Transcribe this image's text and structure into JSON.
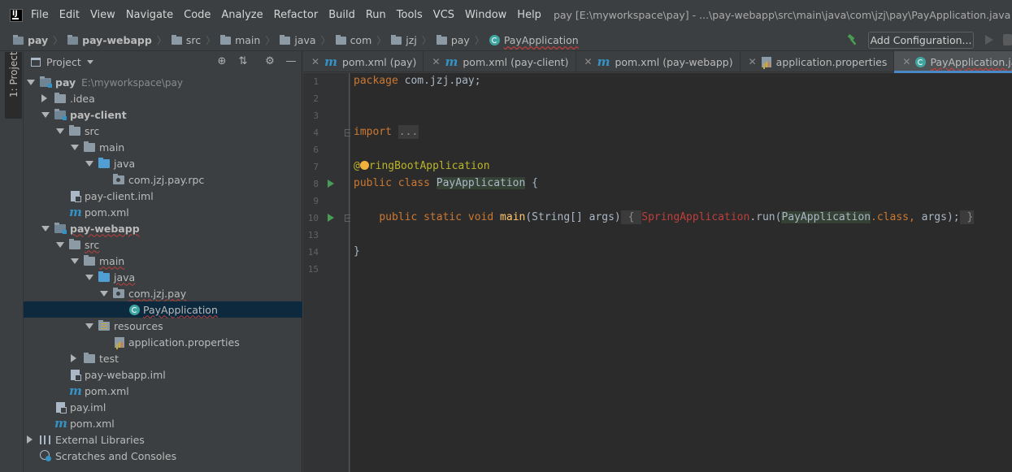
{
  "menu": {
    "items": [
      "File",
      "Edit",
      "View",
      "Navigate",
      "Code",
      "Analyze",
      "Refactor",
      "Build",
      "Run",
      "Tools",
      "VCS",
      "Window",
      "Help"
    ],
    "window_title": "pay [E:\\myworkspace\\pay] - ...\\pay-webapp\\src\\main\\java\\com\\jzj\\pay\\PayApplication.java [pay-webapp]"
  },
  "breadcrumb": [
    "pay",
    "pay-webapp",
    "src",
    "main",
    "java",
    "com",
    "jzj",
    "pay",
    "PayApplication"
  ],
  "toolbar": {
    "add_config_label": "Add Configuration..."
  },
  "side_strip": {
    "project_tab_label": "1: Project"
  },
  "project_panel": {
    "title": "Project",
    "tree": [
      {
        "label": "pay",
        "hint": "E:\\myworkspace\\pay"
      },
      {
        "label": ".idea"
      },
      {
        "label": "pay-client"
      },
      {
        "label": "src"
      },
      {
        "label": "main"
      },
      {
        "label": "java"
      },
      {
        "label": "com.jzj.pay.rpc"
      },
      {
        "label": "pay-client.iml"
      },
      {
        "label": "pom.xml"
      },
      {
        "label": "pay-webapp"
      },
      {
        "label": "src"
      },
      {
        "label": "main"
      },
      {
        "label": "java"
      },
      {
        "label": "com.jzj.pay"
      },
      {
        "label": "PayApplication"
      },
      {
        "label": "resources"
      },
      {
        "label": "application.properties"
      },
      {
        "label": "test"
      },
      {
        "label": "pay-webapp.iml"
      },
      {
        "label": "pom.xml"
      },
      {
        "label": "pay.iml"
      },
      {
        "label": "pom.xml"
      },
      {
        "label": "External Libraries"
      },
      {
        "label": "Scratches and Consoles"
      }
    ]
  },
  "editor_tabs": [
    {
      "label": "pom.xml (pay)"
    },
    {
      "label": "pom.xml (pay-client)"
    },
    {
      "label": "pom.xml (pay-webapp)"
    },
    {
      "label": "application.properties"
    },
    {
      "label": "PayApplication.java"
    }
  ],
  "editor": {
    "line_numbers": [
      "1",
      "2",
      "3",
      "4",
      "6",
      "7",
      "8",
      "9",
      "10",
      "13",
      "14",
      "15"
    ],
    "code": {
      "package_kw": "package",
      "package_name": " com.jzj.pay;",
      "import_kw": "import",
      "import_fold": "...",
      "annotation_at": "@",
      "annotation_rest": "ringBootApplication",
      "public_kw": "public",
      "class_kw": "class",
      "class_name": "PayApplication",
      "open_brace": " {",
      "static_kw": "static",
      "void_kw": "void",
      "method_name": "main",
      "params": "(String[] args)",
      "body_open": " { ",
      "spring_app": "SpringApplication",
      "run_call": ".run(",
      "pay_app": "PayApplication",
      "class_lit": ".class,",
      "args_end": " args);",
      "body_close": " }",
      "close_brace": "}"
    }
  }
}
